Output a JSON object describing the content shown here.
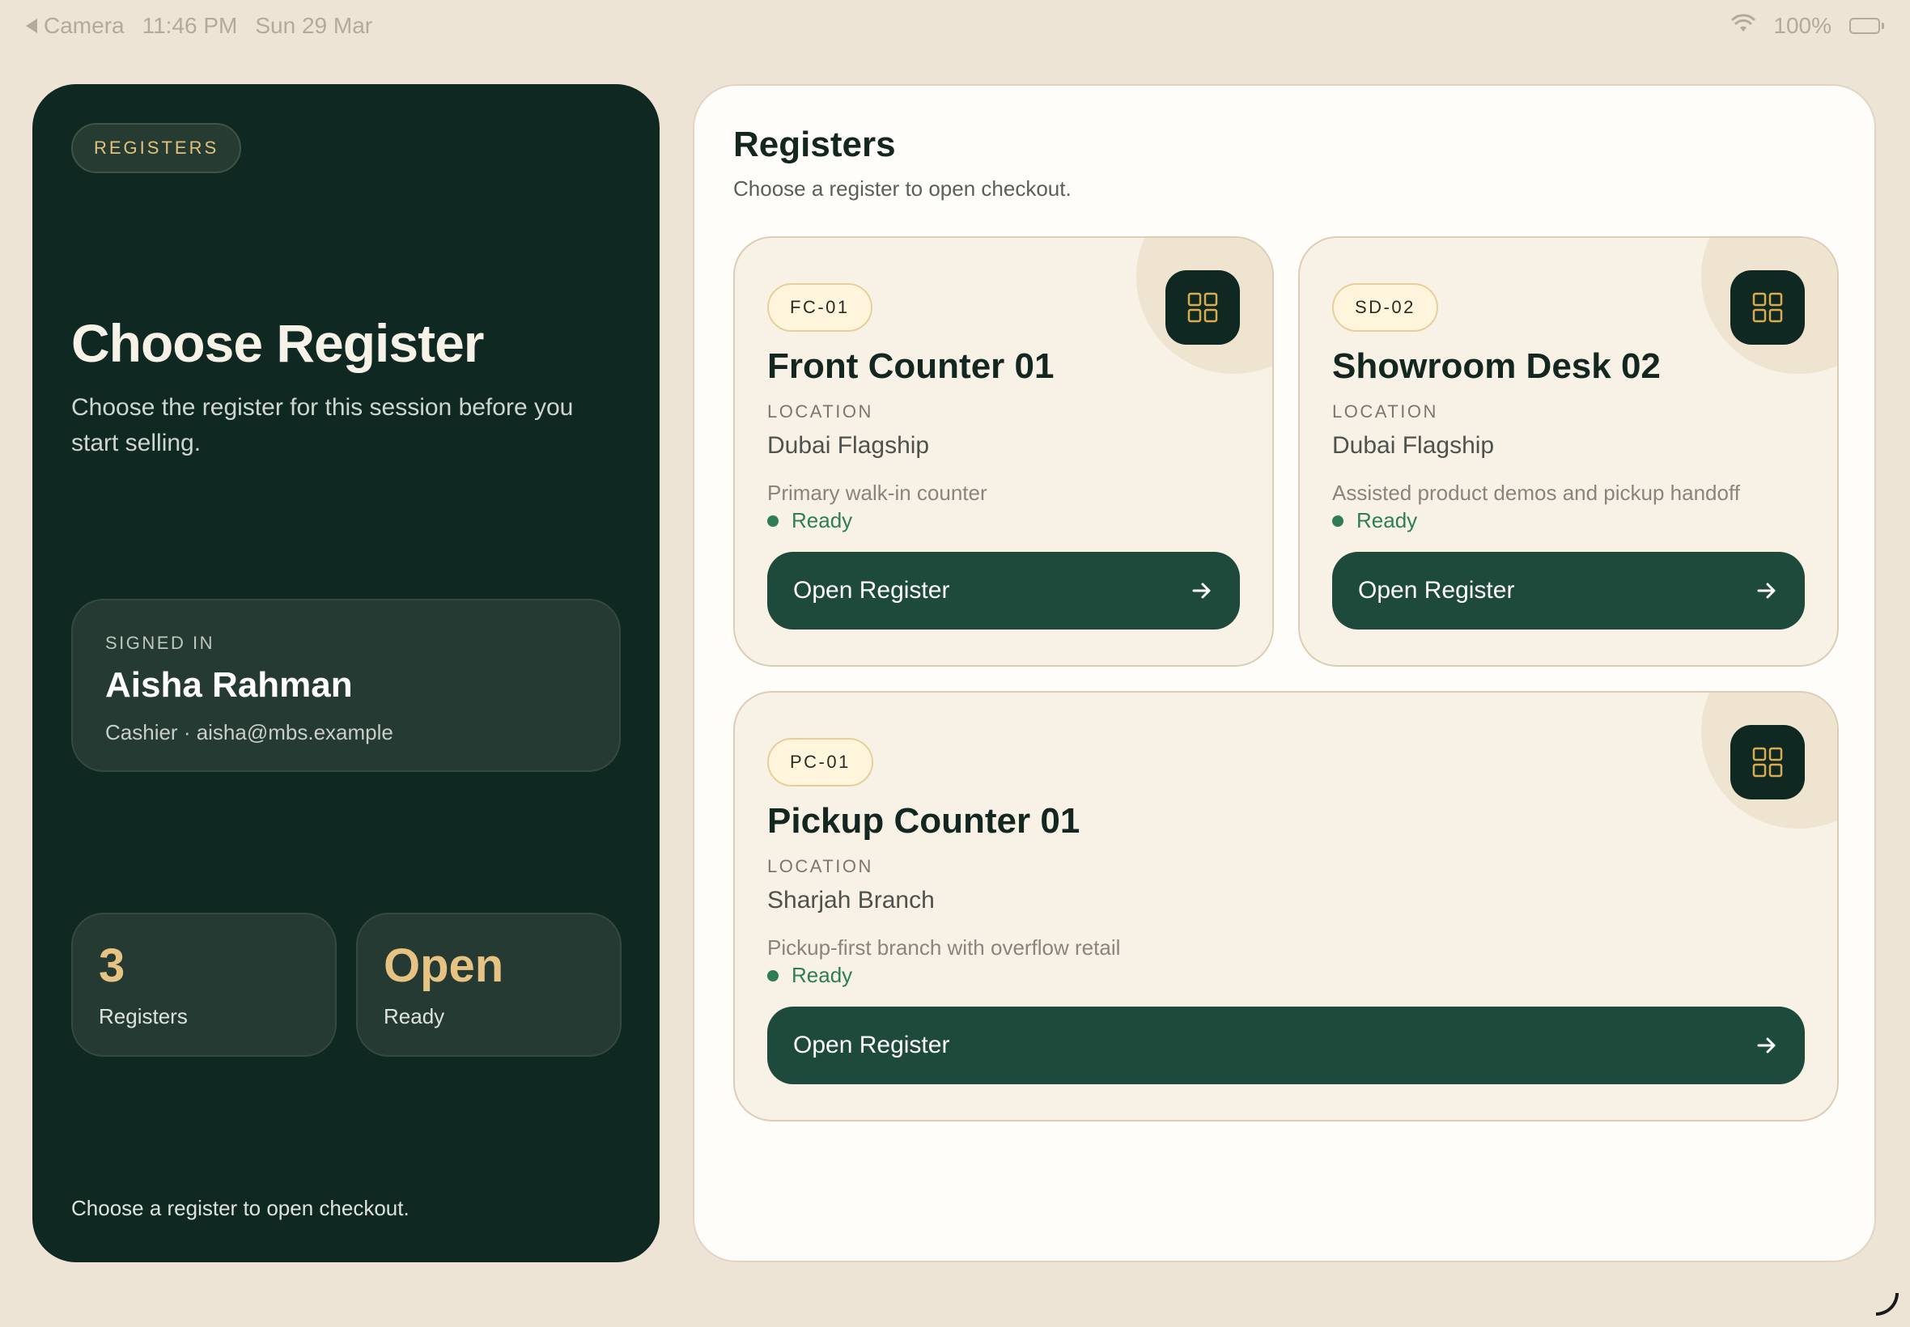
{
  "status_bar": {
    "back_app": "Camera",
    "time": "11:46 PM",
    "date": "Sun 29 Mar",
    "battery": "100%"
  },
  "left": {
    "tag": "REGISTERS",
    "title": "Choose Register",
    "subtitle": "Choose the register for this session before you start selling.",
    "signed_in": {
      "label": "SIGNED IN",
      "name": "Aisha Rahman",
      "role": "Cashier · aisha@mbs.example"
    },
    "stats": [
      {
        "value": "3",
        "label": "Registers"
      },
      {
        "value": "Open",
        "label": "Ready"
      }
    ],
    "footer": "Choose a register to open checkout."
  },
  "right": {
    "title": "Registers",
    "subtitle": "Choose a register to open checkout.",
    "location_label": "LOCATION",
    "button_label": "Open Register",
    "registers": [
      {
        "code": "FC-01",
        "name": "Front Counter 01",
        "location": "Dubai Flagship",
        "description": "Primary walk-in counter",
        "status": "Ready"
      },
      {
        "code": "SD-02",
        "name": "Showroom Desk 02",
        "location": "Dubai Flagship",
        "description": "Assisted product demos and pickup handoff",
        "status": "Ready"
      },
      {
        "code": "PC-01",
        "name": "Pickup Counter 01",
        "location": "Sharjah Branch",
        "description": "Pickup-first branch with overflow retail",
        "status": "Ready"
      }
    ]
  },
  "colors": {
    "background": "#ede4d6",
    "dark_panel": "#102822",
    "accent_gold": "#e7c383",
    "button_green": "#1d4a3b",
    "status_green": "#2e7d55"
  },
  "icons": {
    "register": "grid-icon",
    "button_arrow": "arrow-right-icon",
    "status": "status-dot"
  }
}
